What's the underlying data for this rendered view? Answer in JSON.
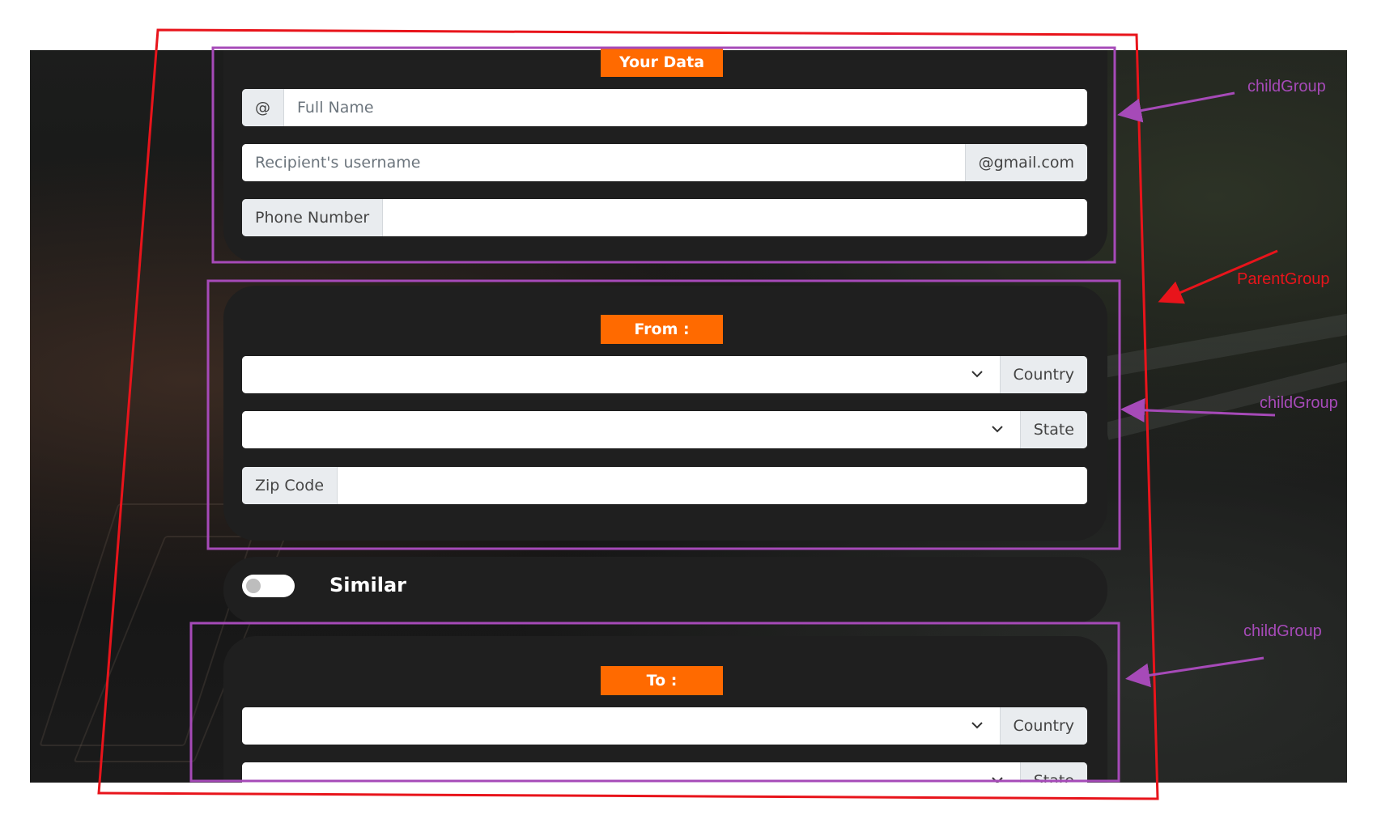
{
  "your_data": {
    "title": "Your Data",
    "full_name": {
      "prefix": "@",
      "placeholder": "Full Name"
    },
    "username": {
      "placeholder": "Recipient's username",
      "suffix": "@gmail.com"
    },
    "phone": {
      "prefix": "Phone Number",
      "value": ""
    }
  },
  "from": {
    "title": "From :",
    "country": {
      "value": "",
      "suffix": "Country"
    },
    "state": {
      "value": "",
      "suffix": "State"
    },
    "zip": {
      "prefix": "Zip Code",
      "value": ""
    }
  },
  "similar": {
    "label": "Similar",
    "on": false
  },
  "to": {
    "title": "To :",
    "country": {
      "value": "",
      "suffix": "Country"
    },
    "state": {
      "value": "",
      "suffix": "State"
    }
  },
  "annotations": {
    "child_group_1": "childGroup",
    "parent_group": "ParentGroup",
    "child_group_2": "childGroup",
    "child_group_3": "childGroup",
    "parent_color": "#e8141b",
    "child_color": "#a64ab8"
  },
  "colors": {
    "accent": "#ff6a00",
    "panel": "#1f1f1f"
  }
}
